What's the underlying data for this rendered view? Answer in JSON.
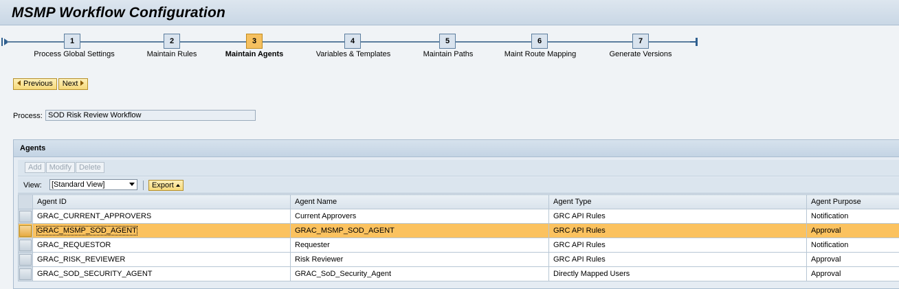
{
  "title": "MSMP Workflow Configuration",
  "roadmap": {
    "steps": [
      {
        "num": "1",
        "label": "Process Global Settings"
      },
      {
        "num": "2",
        "label": "Maintain Rules"
      },
      {
        "num": "3",
        "label": "Maintain Agents"
      },
      {
        "num": "4",
        "label": "Variables & Templates"
      },
      {
        "num": "5",
        "label": "Maintain Paths"
      },
      {
        "num": "6",
        "label": "Maint Route Mapping"
      },
      {
        "num": "7",
        "label": "Generate Versions"
      }
    ],
    "active_step": 3
  },
  "nav": {
    "previous_label": "Previous",
    "next_label": "Next"
  },
  "process": {
    "label": "Process:",
    "value": "SOD Risk Review Workflow"
  },
  "agents": {
    "title": "Agents",
    "toolbar": {
      "add": "Add",
      "modify": "Modify",
      "delete": "Delete"
    },
    "view_label": "View:",
    "view_value": "[Standard View]",
    "export_label": "Export",
    "columns": [
      "Agent ID",
      "Agent Name",
      "Agent Type",
      "Agent Purpose"
    ],
    "rows": [
      [
        "GRAC_CURRENT_APPROVERS",
        "Current Approvers",
        "GRC API Rules",
        "Notification"
      ],
      [
        "GRAC_MSMP_SOD_AGENT",
        "GRAC_MSMP_SOD_AGENT",
        "GRC API Rules",
        "Approval"
      ],
      [
        "GRAC_REQUESTOR",
        "Requester",
        "GRC API Rules",
        "Notification"
      ],
      [
        "GRAC_RISK_REVIEWER",
        "Risk Reviewer",
        "GRC API Rules",
        "Approval"
      ],
      [
        "GRAC_SOD_SECURITY_AGENT",
        "GRAC_SoD_Security_Agent",
        "Directly Mapped Users",
        "Approval"
      ]
    ],
    "selected_row": 1
  },
  "colors": {
    "accent": "#f5c060",
    "selected_row": "#fbc25f",
    "header": "#c9d7e5"
  }
}
